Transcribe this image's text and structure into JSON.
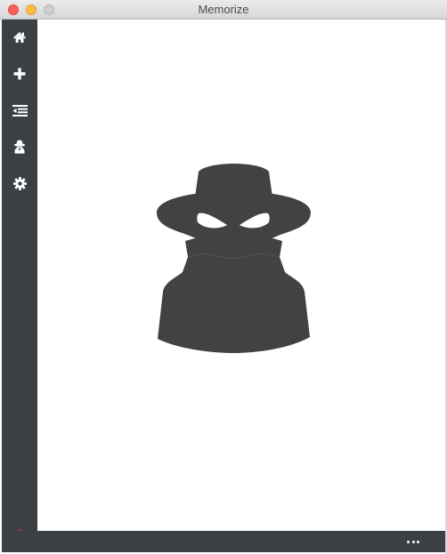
{
  "window": {
    "title": "Memorize",
    "controls": [
      "close",
      "minimize",
      "zoom"
    ]
  },
  "sidebar": {
    "items": [
      {
        "name": "home",
        "icon": "home-icon"
      },
      {
        "name": "add",
        "icon": "plus-icon"
      },
      {
        "name": "list",
        "icon": "list-indent-icon"
      },
      {
        "name": "incognito",
        "icon": "spy-icon"
      },
      {
        "name": "settings",
        "icon": "gear-icon"
      }
    ],
    "power_icon": "power-icon"
  },
  "main": {
    "illustration": "spy-illustration"
  },
  "bottombar": {
    "more_icon": "ellipsis-icon"
  },
  "colors": {
    "sidebar_bg": "#3b4045",
    "icon": "#ffffff",
    "power": "#e0312b",
    "illustration": "#424242"
  }
}
